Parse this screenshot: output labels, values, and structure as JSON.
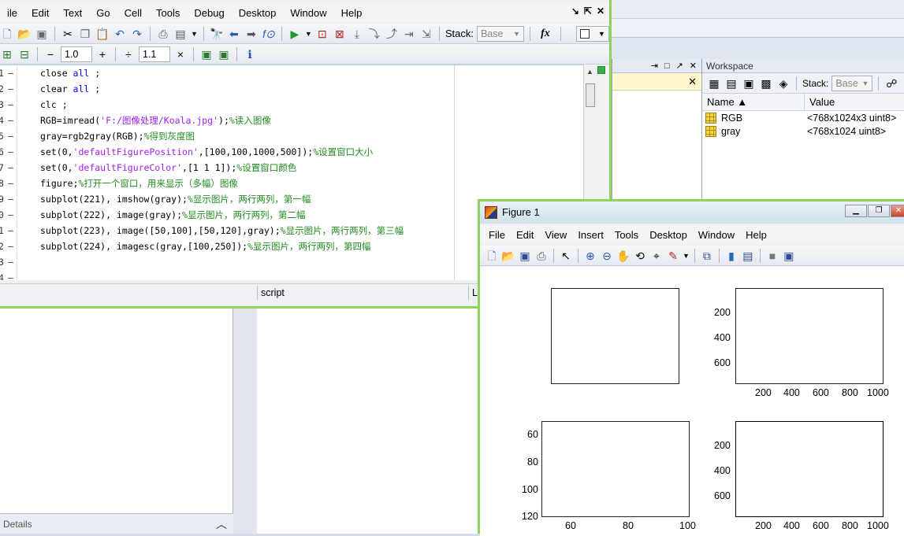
{
  "editor": {
    "menu": [
      "ile",
      "Edit",
      "Text",
      "Go",
      "Cell",
      "Tools",
      "Debug",
      "Desktop",
      "Window",
      "Help"
    ],
    "stack_label": "Stack:",
    "stack_value": "Base",
    "fx_label": "fx",
    "cell_minus": "−",
    "cell_value1": "1.0",
    "cell_plus": "+",
    "cell_div": "÷",
    "cell_value2": "1.1",
    "cell_times": "×",
    "code_lines": [
      {
        "n": "1",
        "parts": [
          [
            "",
            "close "
          ],
          [
            "kw",
            "all"
          ],
          [
            "",
            " ;"
          ]
        ]
      },
      {
        "n": "2",
        "parts": [
          [
            "",
            "clear "
          ],
          [
            "kw",
            "all"
          ],
          [
            "",
            " ;"
          ]
        ]
      },
      {
        "n": "3",
        "parts": [
          [
            "",
            "clc ;"
          ]
        ]
      },
      {
        "n": "4",
        "parts": [
          [
            "",
            "RGB=imread("
          ],
          [
            "str",
            "'F:/图像处理/Koala.jpg'"
          ],
          [
            "",
            ");"
          ],
          [
            "cm",
            "%读入图像"
          ]
        ]
      },
      {
        "n": "5",
        "parts": [
          [
            "",
            "gray=rgb2gray(RGB);"
          ],
          [
            "cm",
            "%得到灰度图"
          ]
        ]
      },
      {
        "n": "6",
        "parts": [
          [
            "",
            "set(0,"
          ],
          [
            "str",
            "'defaultFigurePosition'"
          ],
          [
            "",
            ",[100,100,1000,500]);"
          ],
          [
            "cm",
            "%设置窗口大小"
          ]
        ]
      },
      {
        "n": "7",
        "parts": [
          [
            "",
            "set(0,"
          ],
          [
            "str",
            "'defaultFigureColor'"
          ],
          [
            "",
            ",[1 1 1]);"
          ],
          [
            "cm",
            "%设置窗口颜色"
          ]
        ]
      },
      {
        "n": "8",
        "parts": [
          [
            "",
            "figure;"
          ],
          [
            "cm",
            "%打开一个窗口，用来显示（多幅）图像"
          ]
        ]
      },
      {
        "n": "9",
        "parts": [
          [
            "",
            "subplot(221), imshow(gray);"
          ],
          [
            "cm",
            "%显示图片，两行两列，第一幅"
          ]
        ]
      },
      {
        "n": "0",
        "parts": [
          [
            "",
            "subplot(222), image(gray);"
          ],
          [
            "cm",
            "%显示图片，两行两列，第二幅"
          ]
        ]
      },
      {
        "n": "1",
        "parts": [
          [
            "",
            "subplot(223), image([50,100],[50,120],gray);"
          ],
          [
            "cm",
            "%显示图片，两行两列，第三幅"
          ]
        ]
      },
      {
        "n": "2",
        "parts": [
          [
            "",
            "subplot(224), imagesc(gray,[100,250]);"
          ],
          [
            "cm",
            "%显示图片，两行两列，第四幅"
          ]
        ]
      },
      {
        "n": "3",
        "parts": []
      },
      {
        "n": "4",
        "parts": []
      }
    ],
    "status_script": "script",
    "status_ln": "L"
  },
  "workspace": {
    "title": "Workspace",
    "stack_label": "Stack:",
    "stack_value": "Base",
    "col_name": "Name ▲",
    "col_value": "Value",
    "vars": [
      {
        "name": "RGB",
        "value": "<768x1024x3 uint8>"
      },
      {
        "name": "gray",
        "value": "<768x1024 uint8>"
      }
    ]
  },
  "left_pane": {
    "details_label": "Details"
  },
  "figure": {
    "title": "Figure 1",
    "menu": [
      "File",
      "Edit",
      "View",
      "Insert",
      "Tools",
      "Desktop",
      "Window",
      "Help"
    ],
    "subplot2": {
      "yticks": [
        "200",
        "400",
        "600"
      ],
      "xticks": [
        "200",
        "400",
        "600",
        "800",
        "1000"
      ]
    },
    "subplot3": {
      "yticks": [
        "60",
        "80",
        "100",
        "120"
      ],
      "xticks": [
        "60",
        "80",
        "100"
      ]
    },
    "subplot4": {
      "yticks": [
        "200",
        "400",
        "600"
      ],
      "xticks": [
        "200",
        "400",
        "600",
        "800",
        "1000"
      ]
    }
  },
  "colors": {
    "accent_green": "#8ed35a",
    "keyword": "#0000ff",
    "string": "#a020f0",
    "comment": "#228b22"
  }
}
